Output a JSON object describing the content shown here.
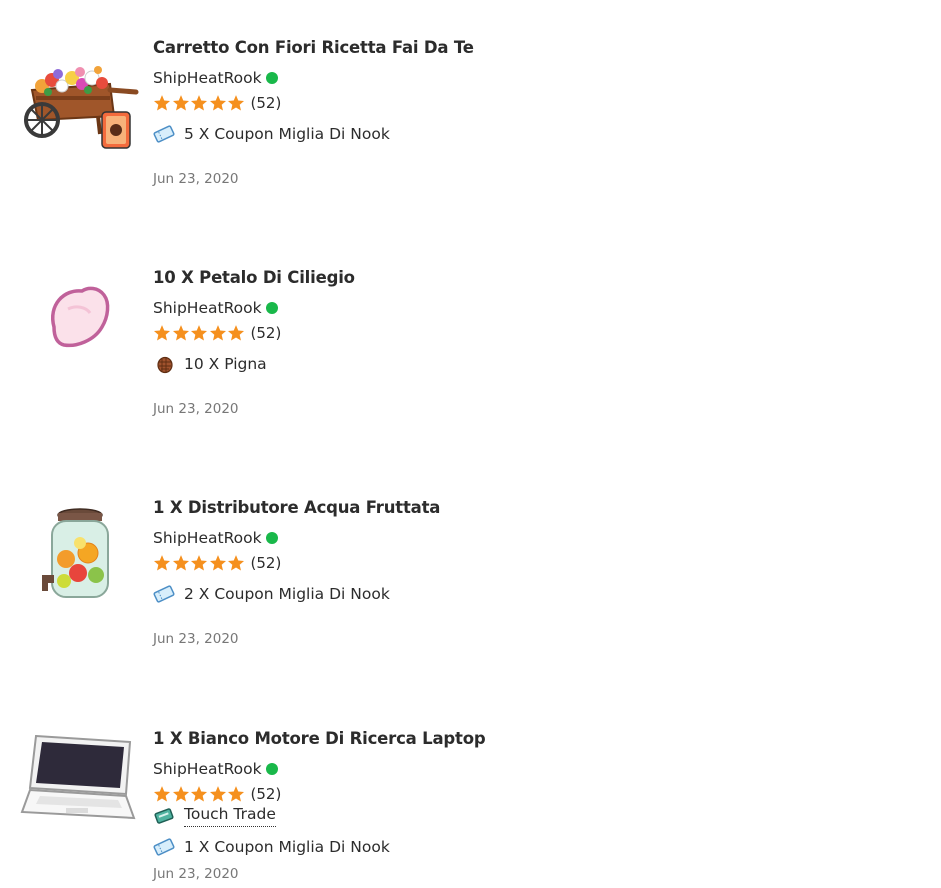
{
  "colors": {
    "online": "#19b84a",
    "star": "#f5901e",
    "date": "#777777"
  },
  "listings": [
    {
      "image_icon": "flower-cart-diy-recipe-icon",
      "title": "Carretto Con Fiori Ricetta Fai Da Te",
      "seller": "ShipHeatRook",
      "online": true,
      "rating_stars": 5,
      "rating_count": "(52)",
      "prices": [
        {
          "icon": "nook-miles-ticket-icon",
          "text": "5 X Coupon Miglia Di Nook"
        }
      ],
      "date": "Jun 23, 2020"
    },
    {
      "image_icon": "cherry-blossom-petal-icon",
      "title": "10 X Petalo Di Ciliegio",
      "seller": "ShipHeatRook",
      "online": true,
      "rating_stars": 5,
      "rating_count": "(52)",
      "prices": [
        {
          "icon": "pine-cone-icon",
          "text": "10 X Pigna"
        }
      ],
      "date": "Jun 23, 2020"
    },
    {
      "image_icon": "fruit-water-dispenser-icon",
      "title": "1 X Distributore Acqua Fruttata",
      "seller": "ShipHeatRook",
      "online": true,
      "rating_stars": 5,
      "rating_count": "(52)",
      "prices": [
        {
          "icon": "nook-miles-ticket-icon",
          "text": "2 X Coupon Miglia Di Nook"
        }
      ],
      "date": "Jun 23, 2020"
    },
    {
      "image_icon": "white-laptop-icon",
      "title": "1 X Bianco Motore Di Ricerca Laptop",
      "seller": "ShipHeatRook",
      "online": true,
      "rating_stars": 5,
      "rating_count": "(52)",
      "prices": [
        {
          "icon": "touch-trade-icon",
          "text": "Touch Trade"
        },
        {
          "icon": "nook-miles-ticket-icon",
          "text": "1 X Coupon Miglia Di Nook"
        }
      ],
      "date": "Jun 23, 2020"
    }
  ]
}
